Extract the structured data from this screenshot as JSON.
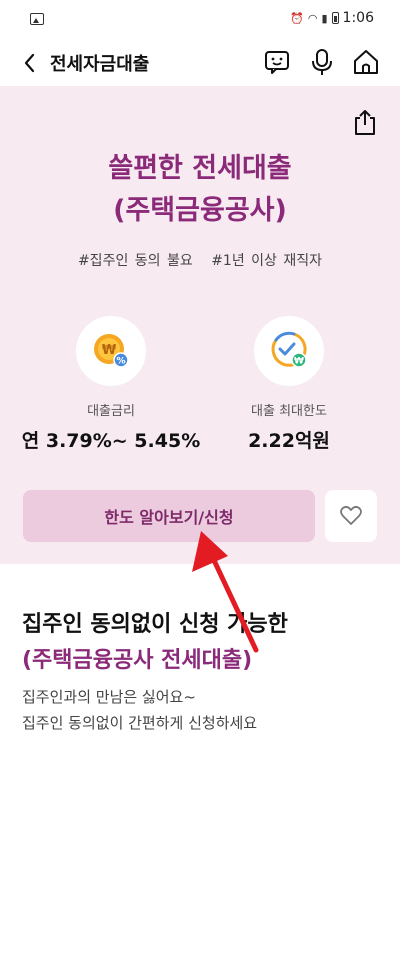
{
  "status_bar": {
    "time": "1:06"
  },
  "header": {
    "title": "전세자금대출"
  },
  "hero": {
    "title_line1": "쓸편한 전세대출",
    "title_line2": "(주택금융공사)",
    "tags": [
      "#집주인 동의 불요",
      "#1년 이상 재직자"
    ],
    "stats": [
      {
        "label": "대출금리",
        "value": "연 3.79%~ 5.45%"
      },
      {
        "label": "대출 최대한도",
        "value": "2.22억원"
      }
    ],
    "apply_label": "한도 알아보기/신청"
  },
  "info": {
    "title_line1": "집주인 동의없이 신청 가능한",
    "title_line2": "(주택금융공사 전세대출)",
    "desc_line1": "집주인과의 만남은 싫어요~",
    "desc_line2": "집주인 동의없이 간편하게 신청하세요"
  },
  "colors": {
    "accent": "#8b2a79",
    "hero_bg": "#f7eaf1",
    "button_bg": "#ebcbdd",
    "annotation_arrow": "#e31b23"
  }
}
